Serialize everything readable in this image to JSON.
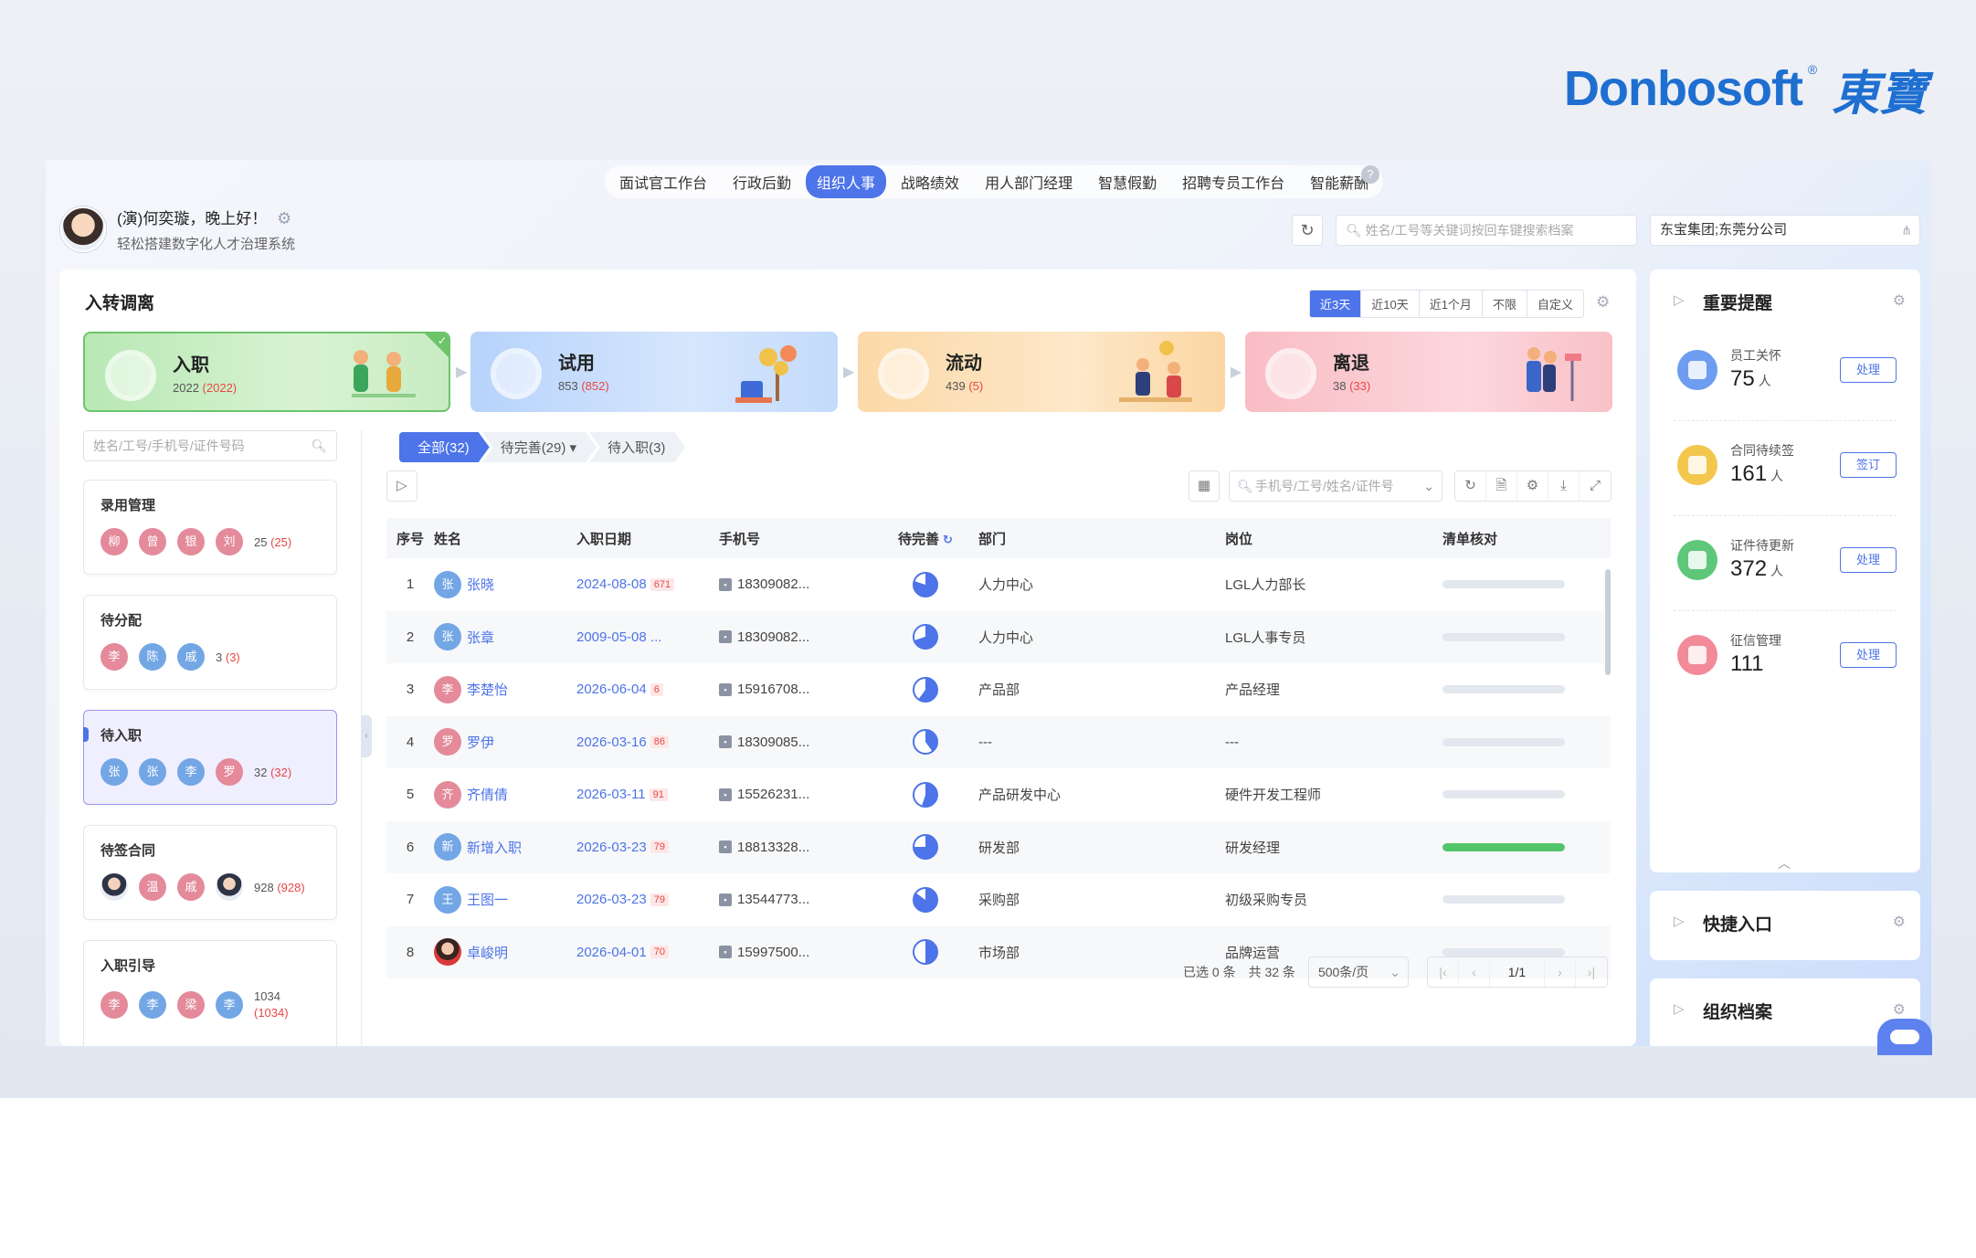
{
  "logo": {
    "text": "Donbosoft",
    "reg": "®",
    "cn": "東寶"
  },
  "topnav": {
    "items": [
      "面试官工作台",
      "行政后勤",
      "组织人事",
      "战略绩效",
      "用人部门经理",
      "智慧假勤",
      "招聘专员工作台",
      "智能薪酬"
    ],
    "active": "组织人事",
    "help": "?"
  },
  "user": {
    "greeting": "(演)何奕璇，晚上好！",
    "slogan": "轻松搭建数字化人才治理系统"
  },
  "search": {
    "placeholder": "姓名/工号等关键词按回车键搜索档案"
  },
  "org": {
    "value": "东宝集团;东莞分公司"
  },
  "main": {
    "title": "入转调离",
    "ranges": [
      "近3天",
      "近10天",
      "近1个月",
      "不限",
      "自定义"
    ],
    "active_range": "近3天"
  },
  "stages": [
    {
      "name": "入职",
      "count": "2022",
      "sub": "(2022)"
    },
    {
      "name": "试用",
      "count": "853",
      "sub": "(852)"
    },
    {
      "name": "流动",
      "count": "439",
      "sub": "(5)"
    },
    {
      "name": "离退",
      "count": "38",
      "sub": "(33)"
    }
  ],
  "side": {
    "search_placeholder": "姓名/工号/手机号/证件号码",
    "categories": [
      {
        "title": "录用管理",
        "avatars": [
          "柳",
          "曾",
          "银",
          "刘"
        ],
        "count": "25",
        "sub": "(25)"
      },
      {
        "title": "待分配",
        "avatars": [
          "李",
          "陈",
          "戚"
        ],
        "count": "3",
        "sub": "(3)"
      },
      {
        "title": "待入职",
        "avatars": [
          "张",
          "张",
          "李",
          "罗"
        ],
        "count": "32",
        "sub": "(32)"
      },
      {
        "title": "待签合同",
        "avatars": [
          "",
          "温",
          "戚",
          ""
        ],
        "count": "928",
        "sub": "(928)"
      },
      {
        "title": "入职引导",
        "avatars": [
          "李",
          "李",
          "梁",
          "李"
        ],
        "count": "1034",
        "sub": "(1034)"
      }
    ]
  },
  "filters": [
    "全部(32)",
    "待完善(29)",
    "待入职(3)"
  ],
  "table": {
    "search_placeholder": "手机号/工号/姓名/证件号",
    "headers": [
      "序号",
      "姓名",
      "入职日期",
      "手机号",
      "待完善",
      "部门",
      "岗位",
      "清单核对"
    ],
    "rows": [
      {
        "no": "1",
        "initial": "张",
        "name": "张晓",
        "date": "2024-08-08",
        "badge": "671",
        "phone": "18309082...",
        "dept": "人力中心",
        "post": "LGL人力部长",
        "progress": 0
      },
      {
        "no": "2",
        "initial": "张",
        "name": "张章",
        "date": "2009-05-08 ...",
        "badge": "",
        "phone": "18309082...",
        "dept": "人力中心",
        "post": "LGL人事专员",
        "progress": 0
      },
      {
        "no": "3",
        "initial": "李",
        "name": "李楚怡",
        "date": "2026-06-04",
        "badge": "6",
        "phone": "15916708...",
        "dept": "产品部",
        "post": "产品经理",
        "progress": 0
      },
      {
        "no": "4",
        "initial": "罗",
        "name": "罗伊",
        "date": "2026-03-16",
        "badge": "86",
        "phone": "18309085...",
        "dept": "---",
        "post": "---",
        "progress": 0
      },
      {
        "no": "5",
        "initial": "齐",
        "name": "齐倩倩",
        "date": "2026-03-11",
        "badge": "91",
        "phone": "15526231...",
        "dept": "产品研发中心",
        "post": "硬件开发工程师",
        "progress": 0
      },
      {
        "no": "6",
        "initial": "新",
        "name": "新增入职",
        "date": "2026-03-23",
        "badge": "79",
        "phone": "18813328...",
        "dept": "研发部",
        "post": "研发经理",
        "progress": 1
      },
      {
        "no": "7",
        "initial": "王",
        "name": "王图一",
        "date": "2026-03-23",
        "badge": "79",
        "phone": "13544773...",
        "dept": "采购部",
        "post": "初级采购专员",
        "progress": 0
      },
      {
        "no": "8",
        "initial": "",
        "name": "卓峻明",
        "date": "2026-04-01",
        "badge": "70",
        "phone": "15997500...",
        "dept": "市场部",
        "post": "品牌运营",
        "progress": 0
      }
    ]
  },
  "pager": {
    "selected": "已选 0 条",
    "total": "共 32 条",
    "size": "500条/页",
    "page": "1/1"
  },
  "reminders": {
    "title": "重要提醒",
    "items": [
      {
        "label": "员工关怀",
        "num": "75",
        "unit": "人",
        "action": "处理",
        "color": "#6e9cf0"
      },
      {
        "label": "合同待续签",
        "num": "161",
        "unit": "人",
        "action": "签订",
        "color": "#f3c64e"
      },
      {
        "label": "证件待更新",
        "num": "372",
        "unit": "人",
        "action": "处理",
        "color": "#5fc77a"
      },
      {
        "label": "征信管理",
        "num": "111",
        "unit": "",
        "action": "处理",
        "color": "#f28a9a"
      }
    ]
  },
  "quick": {
    "title": "快捷入口"
  },
  "archive": {
    "title": "组织档案"
  }
}
